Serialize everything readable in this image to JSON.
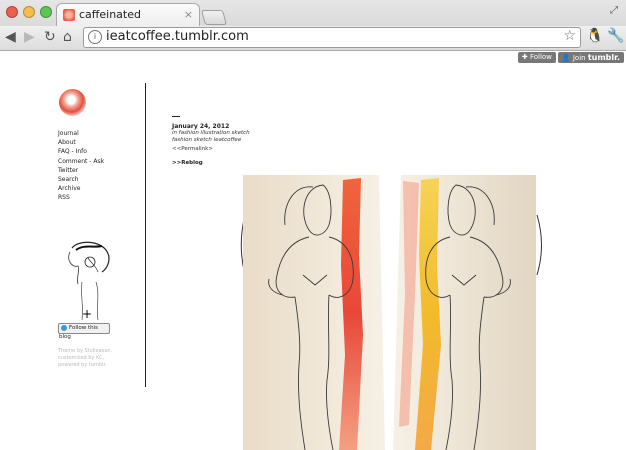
{
  "browser": {
    "tab_title": "caffeinated",
    "tab_close": "×",
    "url": "ieatcoffee.tumblr.com"
  },
  "tumblr_controls": {
    "follow_label": "Follow",
    "join_label": "Join",
    "brand": "tumblr."
  },
  "sidebar": {
    "nav": [
      "Journal",
      "About",
      "FAQ - Info",
      "Comment - Ask",
      "Twitter",
      "Search",
      "Archive",
      "RSS"
    ],
    "follow_badge": "Follow this blog",
    "credits": "Theme by Stolleasan, customized by KC, powered by tumblr."
  },
  "post": {
    "date": "January 24, 2012",
    "tags_line1": "in fashion illustration sketch",
    "tags_line2": "fashion sketch ieatcoffee",
    "permalink": "<<Permalink>",
    "reblog": ">>Reblog"
  },
  "colors": {
    "accent_red": "#e8392a",
    "accent_yellow": "#f2b71b",
    "image_bg": "#f2e8d8"
  }
}
